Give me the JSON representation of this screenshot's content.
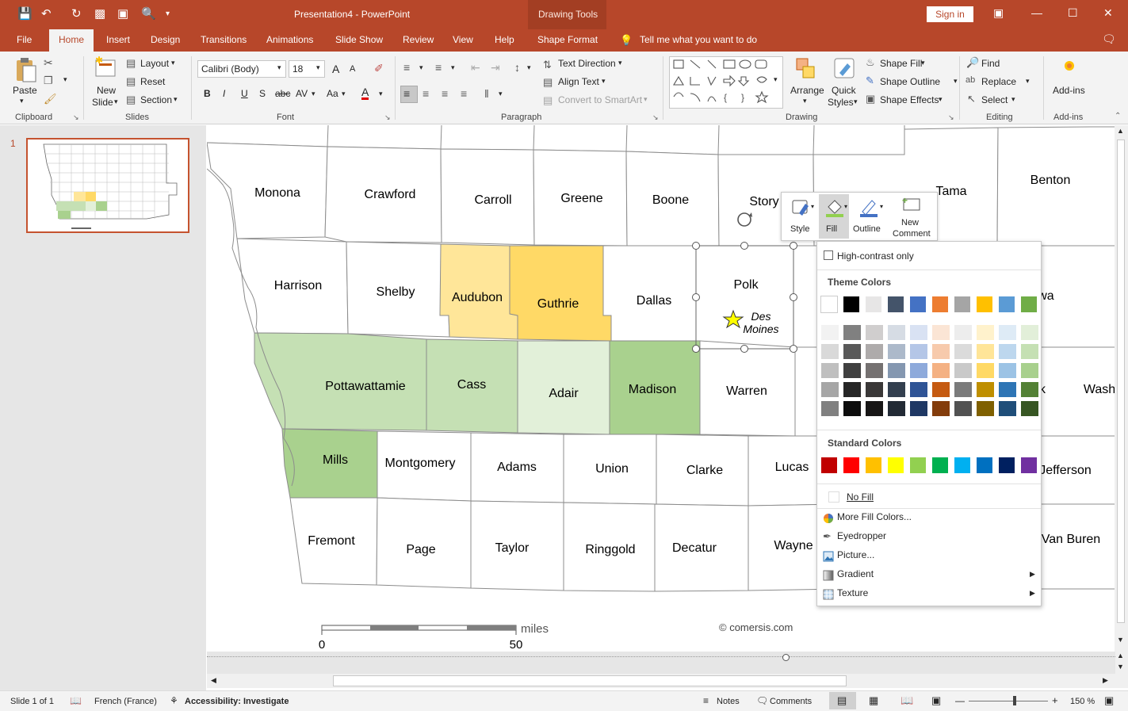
{
  "window": {
    "title": "Presentation4  -  PowerPoint",
    "drawing_tools": "Drawing Tools",
    "sign_in": "Sign in"
  },
  "tabs": [
    "File",
    "Home",
    "Insert",
    "Design",
    "Transitions",
    "Animations",
    "Slide Show",
    "Review",
    "View",
    "Help",
    "Shape Format"
  ],
  "tell_me": "Tell me what you want to do",
  "ribbon": {
    "clipboard": {
      "paste": "Paste",
      "label": "Clipboard"
    },
    "slides": {
      "new_slide_1": "New",
      "new_slide_2": "Slide",
      "layout": "Layout",
      "reset": "Reset",
      "section": "Section",
      "label": "Slides"
    },
    "font": {
      "name": "Calibri (Body)",
      "size": "18",
      "label": "Font",
      "bold": "B",
      "italic": "I",
      "underline": "U",
      "shadow": "S",
      "strike": "abc",
      "spacing": "AV",
      "case": "Aa",
      "grow": "A",
      "shrink": "A"
    },
    "paragraph": {
      "text_direction": "Text Direction",
      "align_text": "Align Text",
      "smartart": "Convert to SmartArt",
      "label": "Paragraph"
    },
    "drawing": {
      "arrange": "Arrange",
      "quick_1": "Quick",
      "quick_2": "Styles",
      "shape_fill": "Shape Fill",
      "shape_outline": "Shape Outline",
      "shape_effects": "Shape Effects",
      "label": "Drawing"
    },
    "editing": {
      "find": "Find",
      "replace": "Replace",
      "select": "Select",
      "label": "Editing"
    },
    "addins": {
      "btn": "Add-ins",
      "label": "Add-ins"
    }
  },
  "thumbnail": {
    "number": "1"
  },
  "map": {
    "counties": [
      {
        "name": "Monona"
      },
      {
        "name": "Crawford"
      },
      {
        "name": "Carroll"
      },
      {
        "name": "Greene"
      },
      {
        "name": "Boone"
      },
      {
        "name": "Story"
      },
      {
        "name": "Tama"
      },
      {
        "name": "Benton"
      },
      {
        "name": "Harrison"
      },
      {
        "name": "Shelby"
      },
      {
        "name": "Audubon"
      },
      {
        "name": "Guthrie"
      },
      {
        "name": "Dallas"
      },
      {
        "name": "Polk"
      },
      {
        "name": "owa"
      },
      {
        "name": "Pottawattamie"
      },
      {
        "name": "Cass"
      },
      {
        "name": "Adair"
      },
      {
        "name": "Madison"
      },
      {
        "name": "Warren"
      },
      {
        "name": "k"
      },
      {
        "name": "Wash"
      },
      {
        "name": "Mills"
      },
      {
        "name": "Montgomery"
      },
      {
        "name": "Adams"
      },
      {
        "name": "Union"
      },
      {
        "name": "Clarke"
      },
      {
        "name": "Lucas"
      },
      {
        "name": "Jefferson"
      },
      {
        "name": "Fremont"
      },
      {
        "name": "Page"
      },
      {
        "name": "Taylor"
      },
      {
        "name": "Ringgold"
      },
      {
        "name": "Decatur"
      },
      {
        "name": "Wayne"
      },
      {
        "name": "Van Buren"
      }
    ],
    "capital_1": "Des",
    "capital_2": "Moines",
    "scale": {
      "unit": "miles",
      "start": "0",
      "end": "50"
    },
    "copyright": "© comersis.com",
    "colors": {
      "audubon": "#ffe699",
      "guthrie": "#ffd966",
      "pott": "#c5e0b4",
      "cass": "#c5e0b4",
      "adair": "#e2f0d9",
      "madison": "#a9d18e",
      "mills": "#a9d18e"
    }
  },
  "mini_toolbar": {
    "style": "Style",
    "fill": "Fill",
    "outline": "Outline",
    "new_comment_1": "New",
    "new_comment_2": "Comment"
  },
  "fill_menu": {
    "high_contrast": "High-contrast only",
    "theme_colors": "Theme Colors",
    "theme_row": [
      "#ffffff",
      "#000000",
      "#e7e6e6",
      "#44546a",
      "#4472c4",
      "#ed7d31",
      "#a5a5a5",
      "#ffc000",
      "#5b9bd5",
      "#70ad47"
    ],
    "shades": [
      [
        "#f2f2f2",
        "#d9d9d9",
        "#bfbfbf",
        "#a6a6a6",
        "#808080"
      ],
      [
        "#808080",
        "#595959",
        "#404040",
        "#262626",
        "#0d0d0d"
      ],
      [
        "#d0cece",
        "#aeabab",
        "#757171",
        "#3a3838",
        "#171616"
      ],
      [
        "#d6dce4",
        "#acb9ca",
        "#8497b0",
        "#333f4f",
        "#222a35"
      ],
      [
        "#d9e2f3",
        "#b4c6e7",
        "#8eaadb",
        "#2f5496",
        "#1f3864"
      ],
      [
        "#fbe5d5",
        "#f7caac",
        "#f4b183",
        "#c55a11",
        "#833c0b"
      ],
      [
        "#ededed",
        "#dbdbdb",
        "#c9c9c9",
        "#7b7b7b",
        "#525252"
      ],
      [
        "#fff2cc",
        "#ffe598",
        "#ffd965",
        "#bf8f00",
        "#7f6000"
      ],
      [
        "#deebf6",
        "#bdd7ee",
        "#9cc3e5",
        "#2e75b5",
        "#1f4e79"
      ],
      [
        "#e2efd9",
        "#c5e0b3",
        "#a8d08d",
        "#538135",
        "#375623"
      ]
    ],
    "standard_colors": "Standard Colors",
    "standard_row": [
      "#c00000",
      "#ff0000",
      "#ffc000",
      "#ffff00",
      "#92d050",
      "#00b050",
      "#00b0f0",
      "#0070c0",
      "#002060",
      "#7030a0"
    ],
    "no_fill": "No Fill",
    "more_colors": "More Fill Colors...",
    "eyedropper": "Eyedropper",
    "picture": "Picture...",
    "gradient": "Gradient",
    "texture": "Texture"
  },
  "status": {
    "slide": "Slide 1 of 1",
    "language": "French (France)",
    "accessibility": "Accessibility: Investigate",
    "notes": "Notes",
    "comments": "Comments",
    "zoom": "150 %"
  }
}
